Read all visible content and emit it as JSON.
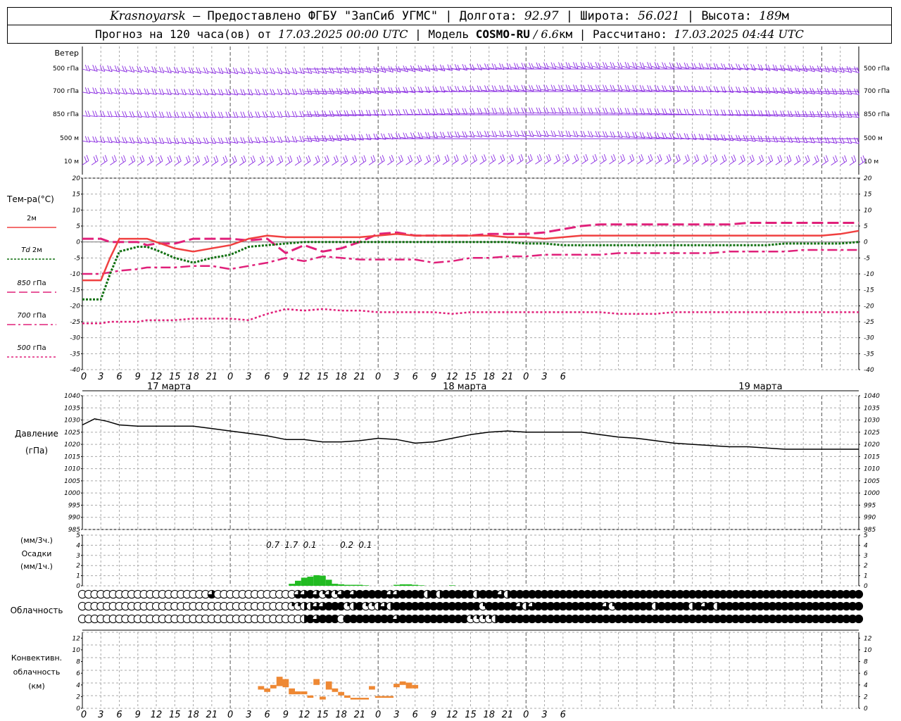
{
  "header": {
    "city": "Krasnoyarsk",
    "provider": " — Предоставлено ФГБУ \"ЗапСиб УГМС\" | Долгота: ",
    "lon": "92.97",
    "lat_label": " | Широта: ",
    "lat": "56.021",
    "alt_label": " | Высота: ",
    "alt": "189",
    "alt_unit": "м",
    "forecast_label": "Прогноз на 120 часа(ов) от ",
    "forecast_time": "17.03.2025 00:00 UTC",
    "model_label": " | Модель ",
    "model": "COSMO-RU",
    "model_res": " / 6.6",
    "model_res_unit": "км",
    "calc_label": " | Рассчитано: ",
    "calc_time": "17.03.2025 04:44 UTC"
  },
  "colors": {
    "wind": "#8a2be2",
    "t2m": "#f04040",
    "td2m": "#107010",
    "t850": "#e0207a",
    "t700": "#e0207a",
    "t500": "#e0207a",
    "pressure": "#000000",
    "precip": "#22bb22",
    "conv": "#ee8833",
    "grid": "#aaaaaa"
  },
  "chart_data": {
    "type": "meteogram",
    "x_hour_labels": [
      "0",
      "3",
      "6",
      "9",
      "12",
      "15",
      "18",
      "21",
      "0",
      "3",
      "6",
      "9",
      "12",
      "15",
      "18",
      "21",
      "0",
      "3",
      "6",
      "9",
      "12",
      "15",
      "18",
      "21",
      "0",
      "3",
      "6"
    ],
    "day_labels": [
      "17 марта",
      "18 марта",
      "19 марта"
    ],
    "wind_panel": {
      "title": "Ветер",
      "levels": [
        "500 гПа",
        "700 гПа",
        "850 гПа",
        "500 м",
        "10 м"
      ]
    },
    "temperature_panel": {
      "title": "Тем-ра(°C)",
      "legend": [
        {
          "label": "2м",
          "italic_prefix": ""
        },
        {
          "label": " 2м",
          "italic_prefix": "Td"
        },
        {
          "label": " гПа",
          "italic_prefix": "850"
        },
        {
          "label": " гПа",
          "italic_prefix": "700"
        },
        {
          "label": " гПа",
          "italic_prefix": "500"
        }
      ],
      "ylim": [
        -40,
        20
      ],
      "yticks": [
        "20",
        "15",
        "10",
        "5",
        "0",
        "-5",
        "-10",
        "-15",
        "-20",
        "-25",
        "-30",
        "-35",
        "-40"
      ],
      "x": [
        0,
        3,
        4.5,
        6,
        9,
        10.5,
        12,
        15,
        18,
        21,
        24,
        27,
        30,
        33,
        36,
        39,
        42,
        45,
        48,
        51,
        54,
        57,
        60,
        63,
        66,
        69,
        72,
        75,
        78,
        81,
        84,
        87,
        90,
        93,
        96,
        99,
        102,
        105,
        108,
        111,
        114,
        117,
        120,
        123,
        126
      ],
      "t2m": [
        -12,
        -12,
        -5,
        1,
        1,
        1,
        0,
        -2,
        -3,
        -2,
        -1,
        1,
        2,
        1.5,
        1.5,
        1.5,
        1.5,
        1.5,
        2,
        2.5,
        2,
        2,
        2,
        2,
        2,
        1.5,
        1.5,
        1,
        1.5,
        2,
        2,
        2,
        2,
        2,
        2,
        2,
        2,
        2,
        2,
        2,
        2,
        2,
        2,
        2.5,
        3.5
      ],
      "td2m": [
        -18,
        -18,
        -10,
        -3,
        -1.5,
        -1.5,
        -2.5,
        -5,
        -6.5,
        -5,
        -4,
        -1.5,
        -1,
        -0.5,
        0,
        0,
        0,
        0,
        0,
        0,
        0,
        0,
        0,
        0,
        0,
        0,
        -0.5,
        -0.5,
        -1,
        -1,
        -1,
        -1,
        -1,
        -1,
        -1,
        -1,
        -1,
        -1,
        -1,
        -1,
        -0.5,
        -0.5,
        -0.5,
        -0.5,
        0
      ],
      "t850": [
        1,
        1,
        0,
        0,
        0,
        -1,
        -0.5,
        -0.5,
        1,
        1,
        1,
        0.5,
        1,
        -3.5,
        -1,
        -3,
        -2,
        0,
        2.5,
        3,
        2,
        2,
        2,
        2,
        2.5,
        2.5,
        2.5,
        3,
        4,
        5,
        5.5,
        5.5,
        5.5,
        5.5,
        5.5,
        5.5,
        5.5,
        5.5,
        6,
        6,
        6,
        6,
        6,
        6,
        6
      ],
      "t700": [
        -10,
        -10,
        -9.5,
        -9,
        -8.5,
        -8,
        -8,
        -8,
        -7.5,
        -7.5,
        -8.5,
        -7.5,
        -6.5,
        -5,
        -6,
        -4.5,
        -5,
        -5.5,
        -5.5,
        -5.5,
        -5.5,
        -6.5,
        -6,
        -5,
        -5,
        -4.5,
        -4.5,
        -4,
        -4,
        -4,
        -4,
        -3.5,
        -3.5,
        -3.5,
        -3.5,
        -3.5,
        -3.5,
        -3,
        -3,
        -3,
        -3,
        -2.5,
        -2.5,
        -2.5,
        -2.5
      ],
      "t500": [
        -25.5,
        -25.5,
        -25,
        -25,
        -25,
        -24.5,
        -24.5,
        -24.5,
        -24,
        -24,
        -24,
        -24.5,
        -22.5,
        -21,
        -21.5,
        -21,
        -21.5,
        -21.5,
        -22,
        -22,
        -22,
        -22,
        -22.5,
        -22,
        -22,
        -22,
        -22,
        -22,
        -22,
        -22,
        -22,
        -22.5,
        -22.5,
        -22.5,
        -22,
        -22,
        -22,
        -22,
        -22,
        -22,
        -22,
        -22,
        -22,
        -22,
        -22
      ]
    },
    "pressure_panel": {
      "title": "Давление",
      "unit": "(гПа)",
      "ylim": [
        985,
        1040
      ],
      "yticks": [
        "1040",
        "1035",
        "1030",
        "1025",
        "1020",
        "1015",
        "1010",
        "1005",
        "1000",
        "995",
        "990",
        "985"
      ],
      "x": [
        0,
        2,
        4,
        6,
        9,
        12,
        15,
        18,
        21,
        24,
        27,
        30,
        33,
        36,
        39,
        42,
        45,
        48,
        51,
        54,
        57,
        60,
        63,
        66,
        69,
        72,
        75,
        78,
        81,
        84,
        87,
        90,
        93,
        96,
        99,
        102,
        105,
        108,
        111,
        114,
        117,
        120,
        123,
        126
      ],
      "values": [
        1028,
        1030.5,
        1029.5,
        1028,
        1027.5,
        1027.5,
        1027.5,
        1027.5,
        1026.5,
        1025.5,
        1024.5,
        1023.5,
        1022,
        1022,
        1021,
        1021,
        1021.5,
        1022.5,
        1022,
        1020.5,
        1021,
        1022.5,
        1024,
        1025,
        1025.5,
        1025,
        1025,
        1025,
        1025,
        1024,
        1023,
        1022.5,
        1021.5,
        1020.5,
        1020,
        1019.5,
        1019,
        1019,
        1018.5,
        1018,
        1018,
        1018,
        1018,
        1018
      ]
    },
    "precip_panel": {
      "label1": "(мм/3ч.)",
      "label2": "Осадки",
      "label3": "(мм/1ч.)",
      "ylim": [
        0,
        5
      ],
      "yticks": [
        "5",
        "4",
        "3",
        "2",
        "1",
        "0"
      ],
      "bars_hour": [
        34,
        35,
        36,
        37,
        38,
        39,
        40,
        41,
        42,
        43,
        44,
        45,
        46,
        47,
        48,
        49,
        50,
        51,
        52,
        53,
        54,
        55,
        56,
        57,
        58,
        59,
        60
      ],
      "bars_mm": [
        0.2,
        0.5,
        0.8,
        0.9,
        1.05,
        1.0,
        0.6,
        0.2,
        0.15,
        0.1,
        0.1,
        0.1,
        0.05,
        0,
        0,
        0,
        0,
        0.1,
        0.15,
        0.15,
        0.1,
        0.05,
        0,
        0,
        0,
        0,
        0.05
      ],
      "totals": [
        {
          "hour": 30,
          "label": "0.7"
        },
        {
          "hour": 33,
          "label": "1.7"
        },
        {
          "hour": 36,
          "label": "0.1"
        },
        {
          "hour": 42,
          "label": "0.2"
        },
        {
          "hour": 45,
          "label": "0.1"
        }
      ]
    },
    "cloud_panel": {
      "title": "Облачность",
      "step_hours": 1,
      "rows": [
        "000000000000000000000300000000000003343131343444443344442424444424443244444444444444444444444444444444444444444444444444444444444444",
        "000000000000000000000000000000000011223344412411232444444444444441444443234444444444431444444244444243424444444444444444444444444444",
        "000000000000000000000000000000000000243444044444444344444444444111124444444444444444444444444444444444444444444444444444444444444444"
      ]
    },
    "convective_panel": {
      "title1": "Конвективн.",
      "title2": "облачность",
      "title3": "(км)",
      "ylim": [
        0,
        13
      ],
      "yticks": [
        "12",
        "10",
        "8",
        "6",
        "4",
        "2",
        "0"
      ],
      "segments": [
        {
          "h0": 28.5,
          "h1": 29.5,
          "bot": 3.2,
          "top": 3.8
        },
        {
          "h0": 29.5,
          "h1": 30.5,
          "bot": 2.8,
          "top": 3.4
        },
        {
          "h0": 30.5,
          "h1": 31.5,
          "bot": 3.4,
          "top": 4.0
        },
        {
          "h0": 31.5,
          "h1": 32.5,
          "bot": 3.8,
          "top": 5.4
        },
        {
          "h0": 32.5,
          "h1": 33.5,
          "bot": 3.6,
          "top": 5.0
        },
        {
          "h0": 33.5,
          "h1": 34.5,
          "bot": 2.4,
          "top": 3.4
        },
        {
          "h0": 34.5,
          "h1": 35.5,
          "bot": 2.4,
          "top": 2.9
        },
        {
          "h0": 35.5,
          "h1": 36.5,
          "bot": 2.4,
          "top": 2.9
        },
        {
          "h0": 36.5,
          "h1": 37.5,
          "bot": 1.8,
          "top": 2.2
        },
        {
          "h0": 37.5,
          "h1": 38.5,
          "bot": 4.0,
          "top": 5.0
        },
        {
          "h0": 38.5,
          "h1": 39.5,
          "bot": 1.5,
          "top": 2.0
        },
        {
          "h0": 39.5,
          "h1": 40.5,
          "bot": 3.2,
          "top": 4.6
        },
        {
          "h0": 40.5,
          "h1": 41.5,
          "bot": 2.8,
          "top": 3.4
        },
        {
          "h0": 41.5,
          "h1": 42.5,
          "bot": 2.2,
          "top": 2.8
        },
        {
          "h0": 42.5,
          "h1": 43.5,
          "bot": 1.8,
          "top": 2.2
        },
        {
          "h0": 43.5,
          "h1": 44.5,
          "bot": 1.5,
          "top": 1.8
        },
        {
          "h0": 44.5,
          "h1": 46.5,
          "bot": 1.5,
          "top": 1.8
        },
        {
          "h0": 46.5,
          "h1": 47.5,
          "bot": 3.2,
          "top": 3.8
        },
        {
          "h0": 47.5,
          "h1": 48.5,
          "bot": 1.8,
          "top": 2.1
        },
        {
          "h0": 48.5,
          "h1": 50.5,
          "bot": 1.8,
          "top": 2.1
        },
        {
          "h0": 50.5,
          "h1": 51.5,
          "bot": 3.6,
          "top": 4.2
        },
        {
          "h0": 51.5,
          "h1": 52.5,
          "bot": 4.0,
          "top": 4.6
        },
        {
          "h0": 52.5,
          "h1": 53.5,
          "bot": 3.4,
          "top": 4.4
        },
        {
          "h0": 53.5,
          "h1": 54.5,
          "bot": 3.4,
          "top": 4.0
        }
      ]
    }
  }
}
